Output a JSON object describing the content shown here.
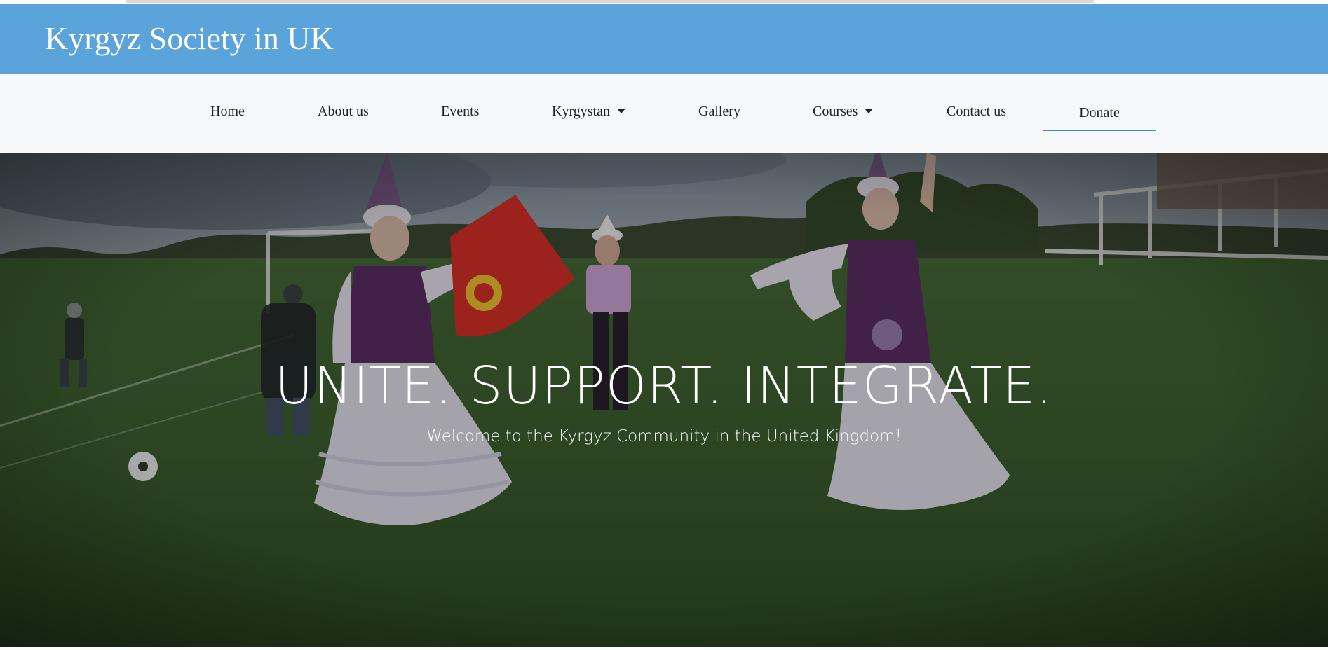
{
  "header": {
    "site_title": "Kyrgyz Society in UK",
    "background_color": "#5ba4db"
  },
  "nav": {
    "items": [
      {
        "label": "Home",
        "dropdown": false
      },
      {
        "label": "About us",
        "dropdown": false
      },
      {
        "label": "Events",
        "dropdown": false
      },
      {
        "label": "Kyrgystan",
        "dropdown": true
      },
      {
        "label": "Gallery",
        "dropdown": false
      },
      {
        "label": "Courses",
        "dropdown": true
      },
      {
        "label": "Contact us",
        "dropdown": false
      }
    ],
    "donate_label": "Donate",
    "donate_border_color": "#3f86d9"
  },
  "hero": {
    "headline": "UNITE. SUPPORT. INTEGRATE.",
    "subtitle": "Welcome to the Kyrgyz Community in the United Kingdom!"
  }
}
